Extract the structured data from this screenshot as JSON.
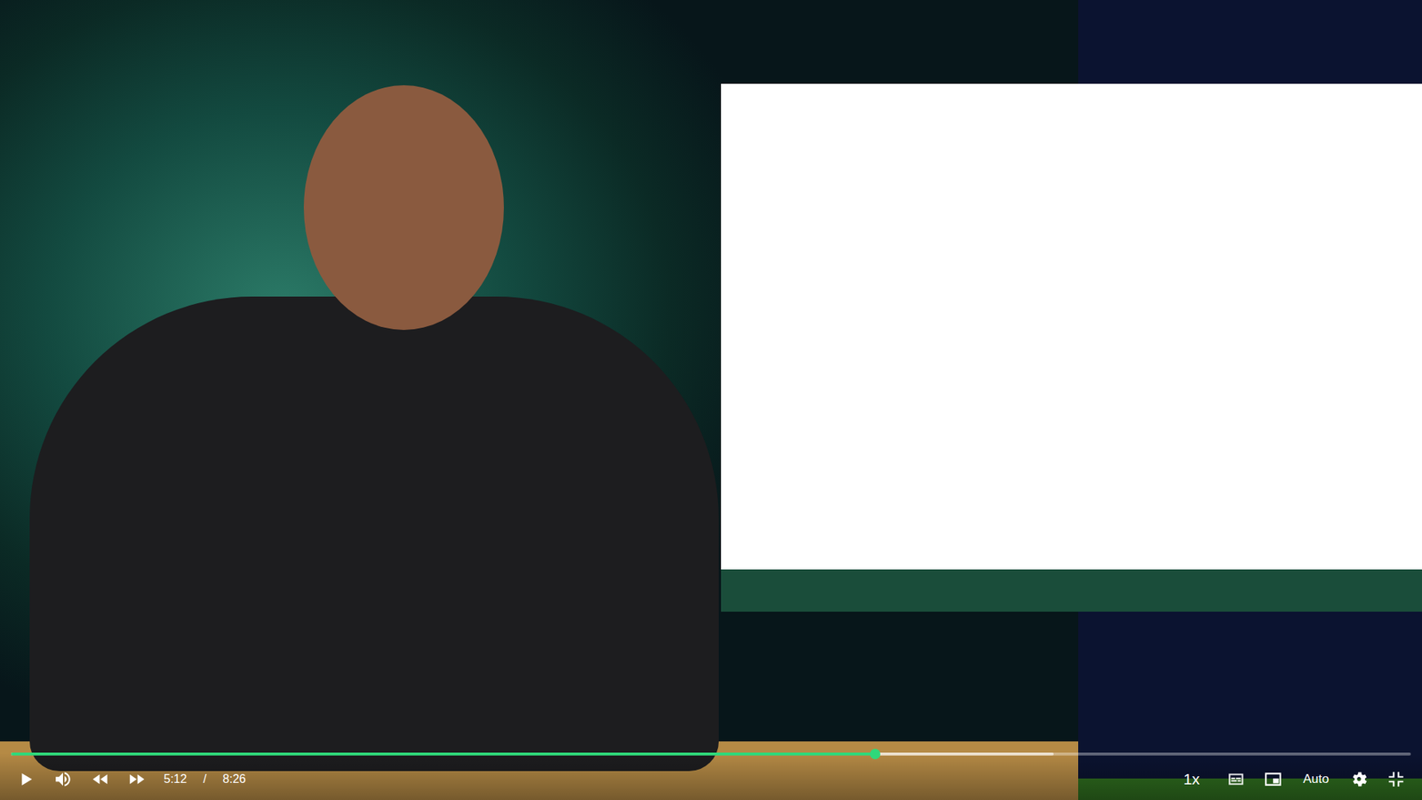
{
  "player": {
    "playing": false,
    "muted": false,
    "progress": {
      "level": 0.617,
      "buffered": 0.745
    },
    "time": {
      "current": "5:12",
      "separator": "/",
      "duration": "8:26"
    },
    "speed": "1x",
    "quality": "Auto",
    "captions_on": false,
    "fullscreen": true
  }
}
